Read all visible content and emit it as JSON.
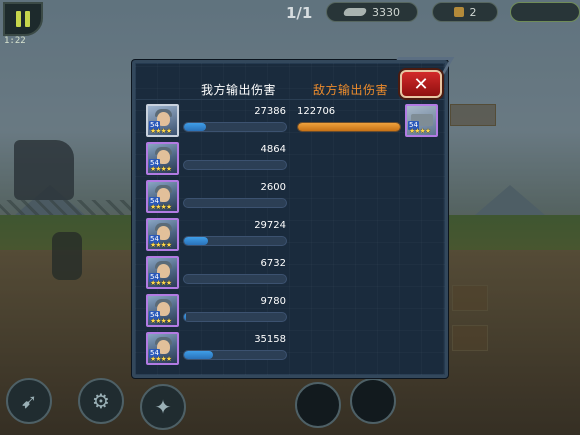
{
  "hud": {
    "wave": "1/1",
    "gold": "3330",
    "item_count": "2",
    "timer": "1:22"
  },
  "panel": {
    "tab_ally": "我方输出伤害",
    "tab_enemy": "敌方输出伤害",
    "close_symbol": "✕",
    "ally_units": [
      {
        "damage": "27386",
        "level": "54",
        "stars": "★★★★",
        "bar_fraction": 0.22
      },
      {
        "damage": "4864",
        "level": "54",
        "stars": "★★★★",
        "bar_fraction": 0.0
      },
      {
        "damage": "2600",
        "level": "54",
        "stars": "★★★★",
        "bar_fraction": 0.0
      },
      {
        "damage": "29724",
        "level": "54",
        "stars": "★★★★",
        "bar_fraction": 0.24
      },
      {
        "damage": "6732",
        "level": "54",
        "stars": "★★★★",
        "bar_fraction": 0.0
      },
      {
        "damage": "9780",
        "level": "54",
        "stars": "★★★★",
        "bar_fraction": 0.02
      },
      {
        "damage": "35158",
        "level": "54",
        "stars": "★★★★",
        "bar_fraction": 0.28
      }
    ],
    "enemy_units": [
      {
        "damage": "122706",
        "level": "54",
        "stars": "★★★★",
        "bar_fraction": 1.0
      }
    ]
  },
  "colors": {
    "ally_bar": "#3f9ee8",
    "enemy_bar": "#f0a23c",
    "enemy_tab": "#ee8c2c",
    "close_button": "#d22a2a"
  },
  "icons": {
    "pause": "pause-icon",
    "close": "close-icon",
    "coin": "coin-icon",
    "chest": "chest-icon"
  }
}
